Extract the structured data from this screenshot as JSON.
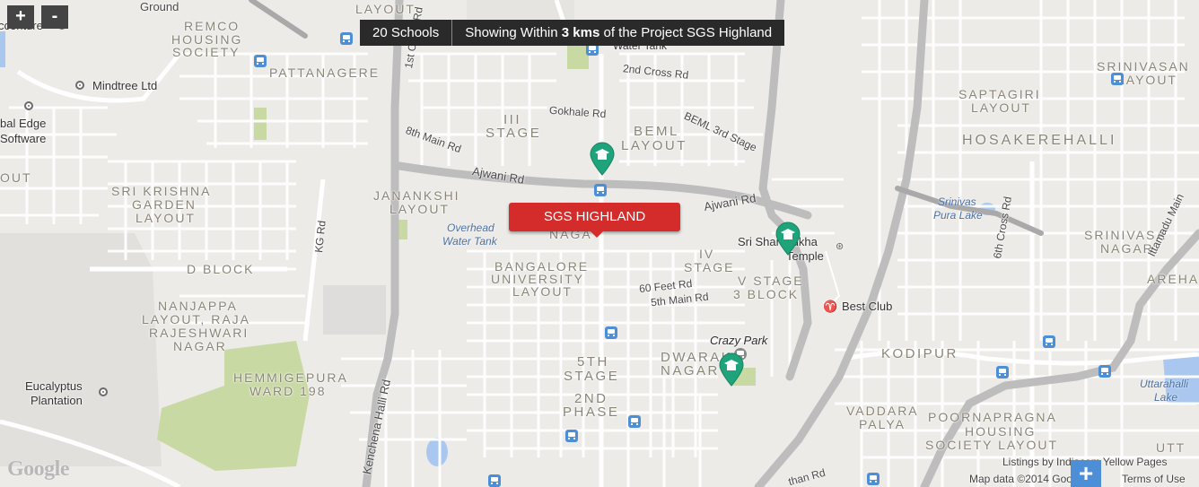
{
  "controls": {
    "zoom_in": "+",
    "zoom_out": "-",
    "expand": "+"
  },
  "info_bar": {
    "count_label": "20 Schools",
    "prefix": "Showing Within ",
    "distance": "3 kms",
    "suffix": " of the Project SGS Highland"
  },
  "project_marker": {
    "label": "SGS HIGHLAND"
  },
  "areas": {
    "ground": "Ground",
    "layout_top": "LAYOUT",
    "remco": "REMCO",
    "housing": "HOUSING",
    "society": "SOCIETY",
    "pattanagere": "PATTANAGERE",
    "srinivasan": "SRINIVASAN",
    "srinivasan_layout": "LAYOUT",
    "saptagiri": "SAPTAGIRI",
    "saptagiri_layout": "LAYOUT",
    "iii": "III",
    "stage": "STAGE",
    "beml": "BEML",
    "beml_layout": "LAYOUT",
    "hosakerehalli": "HOSAKEREHALLI",
    "out": "OUT",
    "sri_krishna": "SRI KRISHNA",
    "garden": "GARDEN",
    "garden_layout": "LAYOUT",
    "janankshi": "JANANKSHI",
    "janankshi_layout": "LAYOUT",
    "nagar_top": "NAGA",
    "srinivasa": "SRINIVASA",
    "srinivasa_nagar": "NAGAR",
    "d_block": "D BLOCK",
    "bangalore": "BANGALORE",
    "university": "UNIVERSITY",
    "univ_layout": "LAYOUT",
    "iv": "IV",
    "iv_stage": "STAGE",
    "v_stage": "V STAGE",
    "block3": "3 BLOCK",
    "arehalli": "AREHA",
    "nanjappa": "NANJAPPA",
    "layout_raja": "LAYOUT, RAJA",
    "rajeshwari": "RAJESHWARI",
    "raj_nagar": "NAGAR",
    "hemmigepura": "HEMMIGEPURA",
    "ward": "WARD 198",
    "fifth": "5TH",
    "fifth_stage": "STAGE",
    "dwaraka": "DWARAKA",
    "dwaraka_nagar": "NAGAR",
    "kodipur": "KODIPUR",
    "second": "2ND",
    "phase": "PHASE",
    "vaddara": "VADDARA",
    "palya": "PALYA",
    "poornapragna": "POORNAPRAGNA",
    "pp_housing": "HOUSING",
    "pp_society": "SOCIETY LAYOUT",
    "utt": "UTT"
  },
  "roads": {
    "cross1": "1st Cross Rd",
    "cross2": "2nd Cross Rd",
    "gokhale": "Gokhale Rd",
    "beml3": "BEML 3rd Stage",
    "main8": "8th Main Rd",
    "ajwani1": "Ajwani Rd",
    "ajwani2": "Ajwani Rd",
    "kg": "KG Rd",
    "feet60": "60 Feet Rd",
    "main5": "5th Main Rd",
    "kenchena": "Kenchena Halli Rd",
    "cross6": "6th Cross Rd",
    "ittamadu": "Ittamadu Main",
    "than": "than Rd"
  },
  "pois": {
    "accenture": "ccenture",
    "mindtree": "Mindtree Ltd",
    "global1": "bal Edge",
    "global2": "Software",
    "water_tank_top": "Water Tank",
    "overhead1": "Overhead",
    "overhead2": "Water Tank",
    "temple1": "Sri Shanmukha",
    "temple2": "Temple",
    "best_club": "Best Club",
    "crazy_park": "Crazy Park",
    "eucalyptus1": "Eucalyptus",
    "eucalyptus2": "Plantation",
    "srinivas_lake1": "Srinivas",
    "srinivas_lake2": "Pura Lake",
    "uttarahalli1": "Uttarahalli",
    "uttarahalli2": "Lake"
  },
  "attribution": {
    "listings": "Listings by Indiacom Yellow Pages",
    "map_data": "Map data ©2014 Google",
    "terms": "Terms of Use",
    "google": "Google"
  },
  "colors": {
    "background": "#ecebe8",
    "street": "#ffffff",
    "major_road": "#bdbdbd",
    "park": "#c9d9a4",
    "water": "#aac8ef",
    "school_pin": "#1fa37a",
    "project_marker": "#d42b2b"
  }
}
